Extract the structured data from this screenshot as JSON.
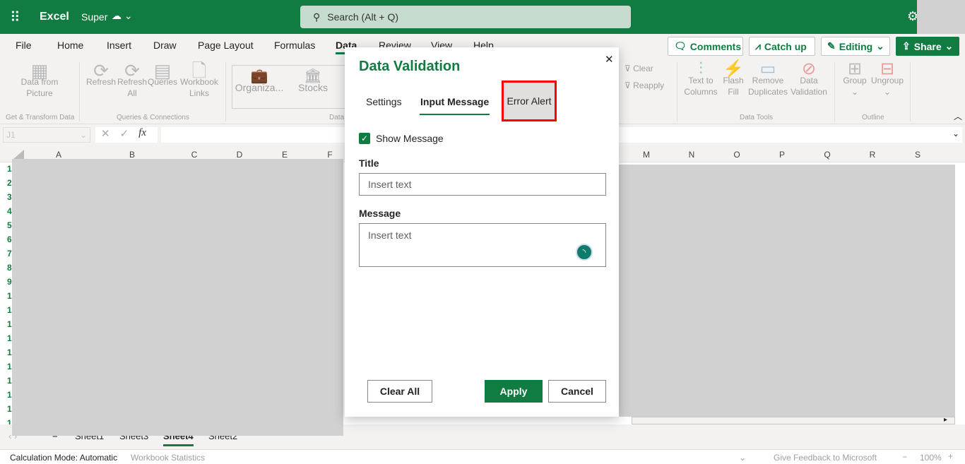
{
  "app": {
    "name": "Excel",
    "doc_name": "Super",
    "search_placeholder": "Search (Alt + Q)"
  },
  "menu": [
    "File",
    "Home",
    "Insert",
    "Draw",
    "Page Layout",
    "Formulas",
    "Data",
    "Review",
    "View",
    "Help"
  ],
  "header_buttons": {
    "comments": "Comments",
    "catch_up": "Catch up",
    "editing": "Editing",
    "share": "Share"
  },
  "ribbon": {
    "data_from_picture": [
      "Data from",
      "Picture"
    ],
    "refresh": "Refresh",
    "refresh_all": [
      "Refresh",
      "All"
    ],
    "queries": "Queries",
    "workbook_links": [
      "Workbook",
      "Links"
    ],
    "organiza": "Organiza...",
    "stocks": "Stocks",
    "clear": "Clear",
    "reapply": "Reapply",
    "text_to_columns": [
      "Text to",
      "Columns"
    ],
    "flash_fill": [
      "Flash",
      "Fill"
    ],
    "remove_duplicates": [
      "Remove",
      "Duplicates"
    ],
    "data_validation": [
      "Data",
      "Validation"
    ],
    "group": "Group",
    "ungroup": "Ungroup",
    "groups": {
      "get_transform": "Get & Transform Data",
      "queries_connections": "Queries & Connections",
      "data_types": "Data",
      "data_tools": "Data Tools",
      "outline": "Outline"
    }
  },
  "formula_bar": {
    "name_box": "J1",
    "fx": "fx"
  },
  "columns_left": [
    "A",
    "B",
    "C",
    "D",
    "E",
    "F"
  ],
  "columns_right": [
    "M",
    "N",
    "O",
    "P",
    "Q",
    "R",
    "S"
  ],
  "rows": [
    "1",
    "2",
    "3",
    "4",
    "5",
    "6",
    "7",
    "8",
    "9",
    "1",
    "1",
    "1",
    "1",
    "1",
    "1",
    "1",
    "1",
    "1",
    "1"
  ],
  "dialog": {
    "title": "Data Validation",
    "tabs": [
      "Settings",
      "Input Message",
      "Error Alert"
    ],
    "active_tab": "Input Message",
    "highlighted_tab": "Error Alert",
    "show_message_label": "Show Message",
    "show_message_checked": true,
    "title_label": "Title",
    "title_placeholder": "Insert text",
    "message_label": "Message",
    "message_placeholder": "Insert text",
    "clear_all": "Clear All",
    "apply": "Apply",
    "cancel": "Cancel"
  },
  "sheets": {
    "tabs": [
      "Sheet1",
      "Sheet3",
      "Sheet4",
      "Sheet2"
    ],
    "active": "Sheet4"
  },
  "status": {
    "calc_mode": "Calculation Mode: Automatic",
    "workbook_stats": "Workbook Statistics",
    "feedback": "Give Feedback to Microsoft",
    "zoom": "100%"
  },
  "colors": {
    "brand": "#107c41",
    "highlight": "#ff0000"
  }
}
